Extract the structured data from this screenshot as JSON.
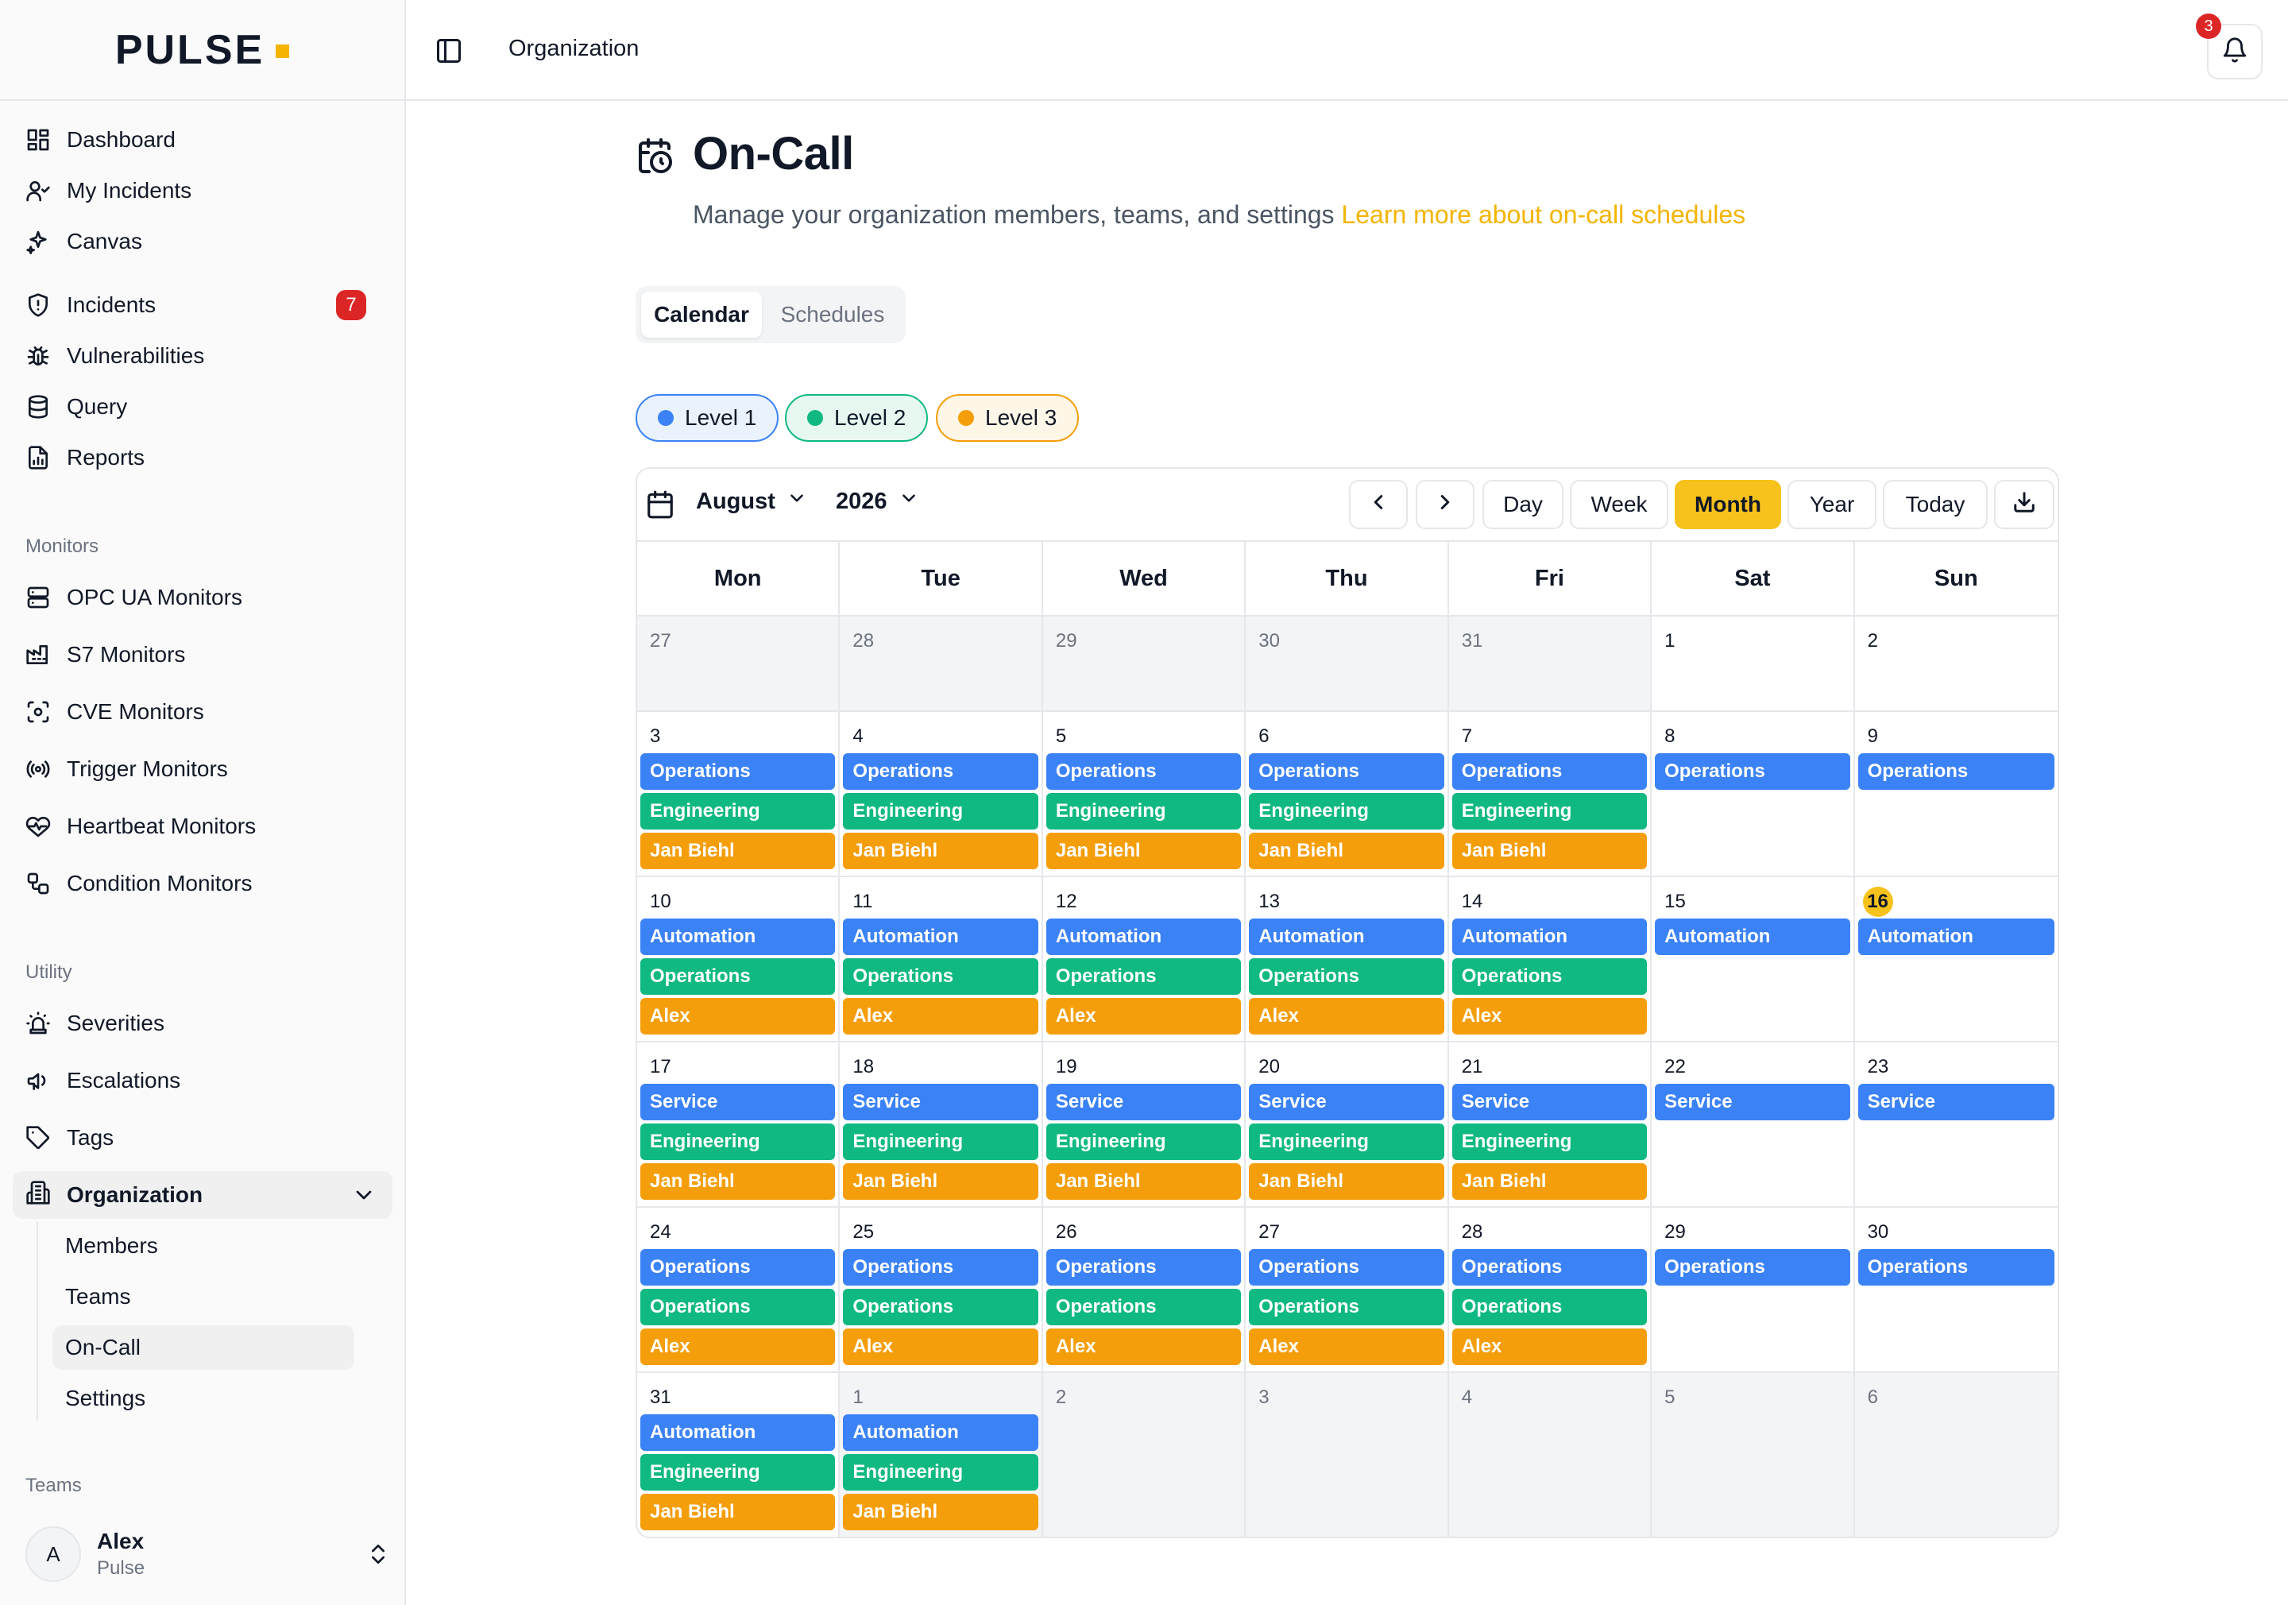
{
  "app": {
    "logo": "PULSE"
  },
  "sidebar": {
    "items": [
      {
        "label": "Dashboard",
        "icon": "dashboard-icon"
      },
      {
        "label": "My Incidents",
        "icon": "user-icon"
      },
      {
        "label": "Canvas",
        "icon": "sparkles-icon"
      },
      {
        "label": "Incidents",
        "icon": "shield-icon",
        "badge": "7"
      },
      {
        "label": "Vulnerabilities",
        "icon": "bug-icon"
      },
      {
        "label": "Query",
        "icon": "database-icon"
      },
      {
        "label": "Reports",
        "icon": "report-icon"
      }
    ],
    "monitors_label": "Monitors",
    "monitors": [
      {
        "label": "OPC UA Monitors",
        "icon": "server-icon"
      },
      {
        "label": "S7 Monitors",
        "icon": "factory-icon"
      },
      {
        "label": "CVE Monitors",
        "icon": "scan-icon"
      },
      {
        "label": "Trigger Monitors",
        "icon": "radio-icon"
      },
      {
        "label": "Heartbeat Monitors",
        "icon": "heart-pulse-icon"
      },
      {
        "label": "Condition Monitors",
        "icon": "workflow-icon"
      }
    ],
    "utility_label": "Utility",
    "utility": [
      {
        "label": "Severities",
        "icon": "siren-icon"
      },
      {
        "label": "Escalations",
        "icon": "megaphone-icon"
      },
      {
        "label": "Tags",
        "icon": "tag-icon"
      }
    ],
    "organization": {
      "label": "Organization",
      "children": [
        "Members",
        "Teams",
        "On-Call",
        "Settings"
      ],
      "active_child": "On-Call"
    },
    "teams_label": "Teams",
    "user": {
      "initial": "A",
      "name": "Alex",
      "org": "Pulse"
    }
  },
  "header": {
    "breadcrumb": "Organization",
    "notifications": "3"
  },
  "page": {
    "title": "On-Call",
    "subtitle": "Manage your organization members, teams, and settings",
    "learn_more": "Learn more about on-call schedules",
    "tabs": [
      "Calendar",
      "Schedules"
    ],
    "active_tab": "Calendar"
  },
  "legend": [
    {
      "label": "Level 1",
      "color": "#3b82f6",
      "bg": "#eaf2fe",
      "border": "#3b82f6"
    },
    {
      "label": "Level 2",
      "color": "#10b981",
      "bg": "#e7f8f1",
      "border": "#10b981"
    },
    {
      "label": "Level 3",
      "color": "#f59e0b",
      "bg": "#fef6e7",
      "border": "#f59e0b"
    }
  ],
  "calendar": {
    "month": "August",
    "year": "2026",
    "views": [
      "Day",
      "Week",
      "Month",
      "Year"
    ],
    "active_view": "Month",
    "today_label": "Today",
    "today_day": "16",
    "weekdays": [
      "Mon",
      "Tue",
      "Wed",
      "Thu",
      "Fri",
      "Sat",
      "Sun"
    ],
    "weeks": [
      [
        {
          "day": "27",
          "outside": true,
          "events": []
        },
        {
          "day": "28",
          "outside": true,
          "events": []
        },
        {
          "day": "29",
          "outside": true,
          "events": []
        },
        {
          "day": "30",
          "outside": true,
          "events": []
        },
        {
          "day": "31",
          "outside": true,
          "events": []
        },
        {
          "day": "1",
          "outside": false,
          "events": []
        },
        {
          "day": "2",
          "outside": false,
          "events": []
        }
      ],
      [
        {
          "day": "3",
          "outside": false,
          "events": [
            [
              "l1",
              "Operations"
            ],
            [
              "l2",
              "Engineering"
            ],
            [
              "l3",
              "Jan Biehl"
            ]
          ]
        },
        {
          "day": "4",
          "outside": false,
          "events": [
            [
              "l1",
              "Operations"
            ],
            [
              "l2",
              "Engineering"
            ],
            [
              "l3",
              "Jan Biehl"
            ]
          ]
        },
        {
          "day": "5",
          "outside": false,
          "events": [
            [
              "l1",
              "Operations"
            ],
            [
              "l2",
              "Engineering"
            ],
            [
              "l3",
              "Jan Biehl"
            ]
          ]
        },
        {
          "day": "6",
          "outside": false,
          "events": [
            [
              "l1",
              "Operations"
            ],
            [
              "l2",
              "Engineering"
            ],
            [
              "l3",
              "Jan Biehl"
            ]
          ]
        },
        {
          "day": "7",
          "outside": false,
          "events": [
            [
              "l1",
              "Operations"
            ],
            [
              "l2",
              "Engineering"
            ],
            [
              "l3",
              "Jan Biehl"
            ]
          ]
        },
        {
          "day": "8",
          "outside": false,
          "events": [
            [
              "l1",
              "Operations"
            ]
          ]
        },
        {
          "day": "9",
          "outside": false,
          "events": [
            [
              "l1",
              "Operations"
            ]
          ]
        }
      ],
      [
        {
          "day": "10",
          "outside": false,
          "events": [
            [
              "l1",
              "Automation"
            ],
            [
              "l2",
              "Operations"
            ],
            [
              "l3",
              "Alex"
            ]
          ]
        },
        {
          "day": "11",
          "outside": false,
          "events": [
            [
              "l1",
              "Automation"
            ],
            [
              "l2",
              "Operations"
            ],
            [
              "l3",
              "Alex"
            ]
          ]
        },
        {
          "day": "12",
          "outside": false,
          "events": [
            [
              "l1",
              "Automation"
            ],
            [
              "l2",
              "Operations"
            ],
            [
              "l3",
              "Alex"
            ]
          ]
        },
        {
          "day": "13",
          "outside": false,
          "events": [
            [
              "l1",
              "Automation"
            ],
            [
              "l2",
              "Operations"
            ],
            [
              "l3",
              "Alex"
            ]
          ]
        },
        {
          "day": "14",
          "outside": false,
          "events": [
            [
              "l1",
              "Automation"
            ],
            [
              "l2",
              "Operations"
            ],
            [
              "l3",
              "Alex"
            ]
          ]
        },
        {
          "day": "15",
          "outside": false,
          "events": [
            [
              "l1",
              "Automation"
            ]
          ]
        },
        {
          "day": "16",
          "outside": false,
          "events": [
            [
              "l1",
              "Automation"
            ]
          ]
        }
      ],
      [
        {
          "day": "17",
          "outside": false,
          "events": [
            [
              "l1",
              "Service"
            ],
            [
              "l2",
              "Engineering"
            ],
            [
              "l3",
              "Jan Biehl"
            ]
          ]
        },
        {
          "day": "18",
          "outside": false,
          "events": [
            [
              "l1",
              "Service"
            ],
            [
              "l2",
              "Engineering"
            ],
            [
              "l3",
              "Jan Biehl"
            ]
          ]
        },
        {
          "day": "19",
          "outside": false,
          "events": [
            [
              "l1",
              "Service"
            ],
            [
              "l2",
              "Engineering"
            ],
            [
              "l3",
              "Jan Biehl"
            ]
          ]
        },
        {
          "day": "20",
          "outside": false,
          "events": [
            [
              "l1",
              "Service"
            ],
            [
              "l2",
              "Engineering"
            ],
            [
              "l3",
              "Jan Biehl"
            ]
          ]
        },
        {
          "day": "21",
          "outside": false,
          "events": [
            [
              "l1",
              "Service"
            ],
            [
              "l2",
              "Engineering"
            ],
            [
              "l3",
              "Jan Biehl"
            ]
          ]
        },
        {
          "day": "22",
          "outside": false,
          "events": [
            [
              "l1",
              "Service"
            ]
          ]
        },
        {
          "day": "23",
          "outside": false,
          "events": [
            [
              "l1",
              "Service"
            ]
          ]
        }
      ],
      [
        {
          "day": "24",
          "outside": false,
          "events": [
            [
              "l1",
              "Operations"
            ],
            [
              "l2",
              "Operations"
            ],
            [
              "l3",
              "Alex"
            ]
          ]
        },
        {
          "day": "25",
          "outside": false,
          "events": [
            [
              "l1",
              "Operations"
            ],
            [
              "l2",
              "Operations"
            ],
            [
              "l3",
              "Alex"
            ]
          ]
        },
        {
          "day": "26",
          "outside": false,
          "events": [
            [
              "l1",
              "Operations"
            ],
            [
              "l2",
              "Operations"
            ],
            [
              "l3",
              "Alex"
            ]
          ]
        },
        {
          "day": "27",
          "outside": false,
          "events": [
            [
              "l1",
              "Operations"
            ],
            [
              "l2",
              "Operations"
            ],
            [
              "l3",
              "Alex"
            ]
          ]
        },
        {
          "day": "28",
          "outside": false,
          "events": [
            [
              "l1",
              "Operations"
            ],
            [
              "l2",
              "Operations"
            ],
            [
              "l3",
              "Alex"
            ]
          ]
        },
        {
          "day": "29",
          "outside": false,
          "events": [
            [
              "l1",
              "Operations"
            ]
          ]
        },
        {
          "day": "30",
          "outside": false,
          "events": [
            [
              "l1",
              "Operations"
            ]
          ]
        }
      ],
      [
        {
          "day": "31",
          "outside": false,
          "events": [
            [
              "l1",
              "Automation"
            ],
            [
              "l2",
              "Engineering"
            ],
            [
              "l3",
              "Jan Biehl"
            ]
          ]
        },
        {
          "day": "1",
          "outside": true,
          "events": [
            [
              "l1",
              "Automation"
            ],
            [
              "l2",
              "Engineering"
            ],
            [
              "l3",
              "Jan Biehl"
            ]
          ]
        },
        {
          "day": "2",
          "outside": true,
          "events": []
        },
        {
          "day": "3",
          "outside": true,
          "events": []
        },
        {
          "day": "4",
          "outside": true,
          "events": []
        },
        {
          "day": "5",
          "outside": true,
          "events": []
        },
        {
          "day": "6",
          "outside": true,
          "events": []
        }
      ]
    ]
  }
}
